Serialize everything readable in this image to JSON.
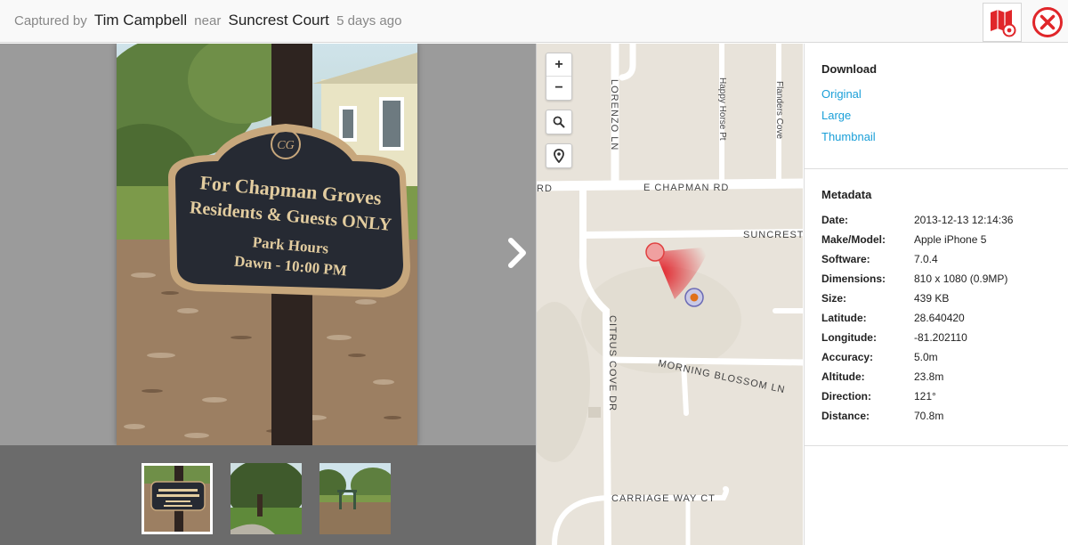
{
  "header": {
    "captured_by_prefix": "Captured by",
    "user_name": "Tim Campbell",
    "near_word": "near",
    "location": "Suncrest Court",
    "time_ago": "5 days ago"
  },
  "map": {
    "zoom_in": "+",
    "zoom_out": "−",
    "streets": {
      "e_chapman": "E CHAPMAN RD",
      "rd_left": "RD",
      "lorenzo": "LORENZO LN",
      "happy_horse": "Happy Horse Pt",
      "flanders": "Flanders Cove",
      "suncrest": "SUNCREST C",
      "citrus_cove": "CITRUS COVE DR",
      "morning_blossom": "MORNING BLOSSOM LN",
      "carriage_way": "CARRIAGE WAY CT"
    }
  },
  "download": {
    "title": "Download",
    "original": "Original",
    "large": "Large",
    "thumbnail": "Thumbnail"
  },
  "metadata": {
    "title": "Metadata",
    "rows": [
      {
        "key": "Date:",
        "value": "2013-12-13 12:14:36"
      },
      {
        "key": "Make/Model:",
        "value": "Apple iPhone 5"
      },
      {
        "key": "Software:",
        "value": "7.0.4"
      },
      {
        "key": "Dimensions:",
        "value": "810 x 1080 (0.9MP)"
      },
      {
        "key": "Size:",
        "value": "439 KB"
      },
      {
        "key": "Latitude:",
        "value": "28.640420"
      },
      {
        "key": "Longitude:",
        "value": "-81.202110"
      },
      {
        "key": "Accuracy:",
        "value": "5.0m"
      },
      {
        "key": "Altitude:",
        "value": "23.8m"
      },
      {
        "key": "Direction:",
        "value": "121°"
      },
      {
        "key": "Distance:",
        "value": "70.8m"
      }
    ]
  },
  "photo": {
    "sign_line1": "For Chapman Groves",
    "sign_line2": "Residents & Guests ONLY",
    "sign_line3": "Park Hours",
    "sign_line4": "Dawn - 10:00 PM"
  },
  "colors": {
    "link": "#1a9fd8",
    "close": "#e0262a",
    "map_bg": "#e8e3da"
  }
}
